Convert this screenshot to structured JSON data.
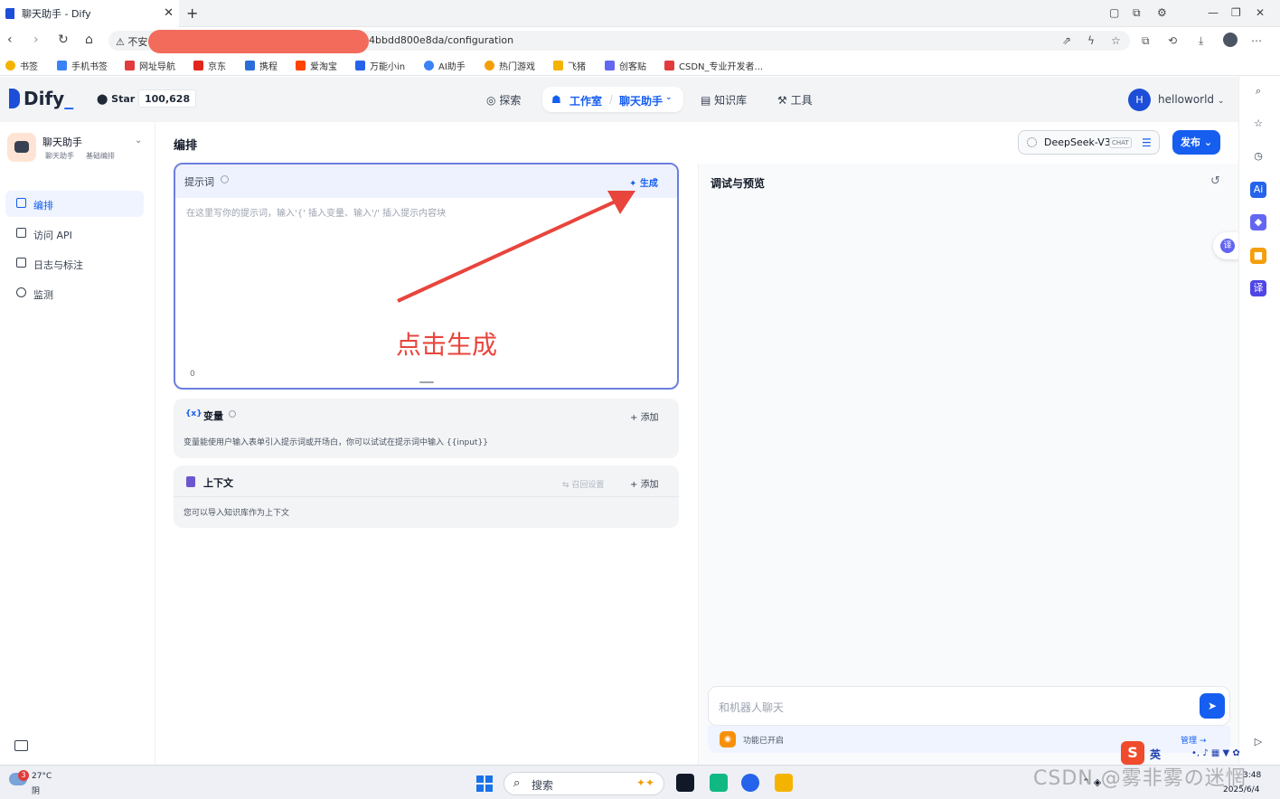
{
  "browser": {
    "tab_title": "聊天助手 - Dify",
    "url_prefix": "不安",
    "url": "4bbdd800e8da/configuration",
    "bookmarks": [
      {
        "label": "书签",
        "color": "#f5b301"
      },
      {
        "label": "手机书签",
        "color": "#3b82f6"
      },
      {
        "label": "网址导航",
        "color": "#e23b3b"
      },
      {
        "label": "京东",
        "color": "#e1251b"
      },
      {
        "label": "携程",
        "color": "#2b6cd8"
      },
      {
        "label": "爱淘宝",
        "color": "#ff4400"
      },
      {
        "label": "万能小in",
        "color": "#2563eb"
      },
      {
        "label": "AI助手",
        "color": "#3b82f6"
      },
      {
        "label": "热门游戏",
        "color": "#f59e0b"
      },
      {
        "label": "飞猪",
        "color": "#f5b301"
      },
      {
        "label": "创客贴",
        "color": "#6366f1"
      },
      {
        "label": "CSDN_专业开发者...",
        "color": "#e23b3b"
      }
    ]
  },
  "header": {
    "logo": "Dify",
    "star_label": "Star",
    "star_count": "100,628",
    "nav": {
      "explore": "探索",
      "studio": "工作室",
      "app": "聊天助手",
      "knowledge": "知识库",
      "tools": "工具"
    },
    "user_initial": "H",
    "user_name": "helloworld"
  },
  "app": {
    "name": "聊天助手",
    "tag1": "聊天助手",
    "tag2": "基础编排",
    "menu": [
      "编排",
      "访问 API",
      "日志与标注",
      "监测"
    ]
  },
  "main": {
    "title": "编排",
    "model_name": "DeepSeek-V3",
    "model_tag": "CHAT",
    "publish": "发布",
    "prompt": {
      "title": "提示词",
      "generate": "生成",
      "placeholder": "在这里写你的提示词，输入'{' 插入变量、输入'/' 插入提示内容块",
      "count": "0"
    },
    "variables": {
      "icon": "{x}",
      "title": "变量",
      "add": "添加",
      "desc": "变量能使用户输入表单引入提示词或开场白，你可以试试在提示词中输入 {{input}}"
    },
    "context": {
      "title": "上下文",
      "recall": "召回设置",
      "add": "添加",
      "desc": "您可以导入知识库作为上下文"
    }
  },
  "debug": {
    "title": "调试与预览",
    "input_placeholder": "和机器人聊天",
    "feature_text": "功能已开启",
    "manage": "管理"
  },
  "annotation": {
    "text": "点击生成",
    "color": "#e8453c"
  },
  "taskbar": {
    "weather_badge": "3",
    "temperature": "27°C",
    "condition": "阴",
    "search": "搜索",
    "time": "3:48",
    "date": "2025/6/4",
    "ime_lang": "英"
  },
  "watermark": "CSDN @雾非雾の迷惘"
}
